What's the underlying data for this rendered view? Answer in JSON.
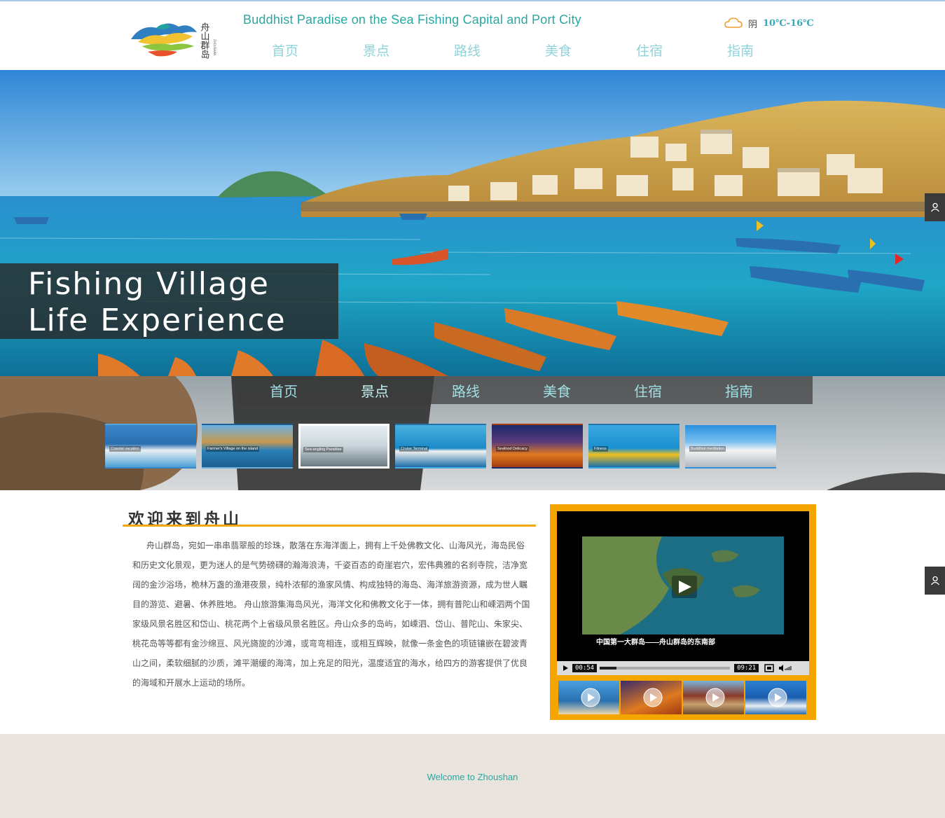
{
  "header": {
    "slogan": "Buddhist Paradise on the Sea Fishing Capital and Port City",
    "logo_text": "舟山群岛",
    "weather": {
      "condition": "阴",
      "temperature": "10℃-16℃",
      "icon": "cloud-icon"
    },
    "nav": [
      "首页",
      "景点",
      "路线",
      "美食",
      "住宿",
      "指南"
    ]
  },
  "hero": {
    "caption_line1": "Fishing Village",
    "caption_line2": "Life Experience"
  },
  "strip": {
    "nav": [
      "首页",
      "景点",
      "路线",
      "美食",
      "住宿",
      "指南"
    ],
    "thumbs": [
      {
        "label": "Coastal vacation"
      },
      {
        "label": "Farmer's Village on the island"
      },
      {
        "label": "Sea-angling Paradise"
      },
      {
        "label": "Cruise Terminal"
      },
      {
        "label": "Seafood Delicacy"
      },
      {
        "label": "Fitness"
      },
      {
        "label": "Buddhist meditation"
      }
    ]
  },
  "welcome": {
    "title": "欢迎来到舟山",
    "body": "舟山群岛，宛如一串串翡翠般的珍珠，散落在东海洋面上，拥有上千处佛教文化、山海风光，海岛民俗和历史文化景观，更为迷人的是气势磅礴的瀚海浪涛，千姿百态的奇崖岩穴，宏伟典雅的名刹寺院，洁净宽阔的金沙浴场，桅林万盏的渔港夜景，纯朴浓郁的渔家风情、构成独特的海岛、海洋旅游资源，成为世人瞩目的游览、避暑、休养胜地。 舟山旅游集海岛风光，海洋文化和佛教文化于一体，拥有普陀山和嵊泗两个国家级风景名胜区和岱山、桃花两个上省级风景名胜区。舟山众多的岛屿，如嵊泗、岱山、普陀山、朱家尖、桃花岛等等都有金沙绵亘、风光旖旎的沙滩，或弯弯相连，或相互辉映，就像一条金色的项链镶嵌在碧波青山之间，柔软细腻的沙质，滩平潮缓的海湾，加上充足的阳光，温度适宜的海水，给四方的游客提供了优良的海域和开展水上运动的场所。"
  },
  "video": {
    "caption": "中国第一大群岛——舟山群岛的东南部",
    "current_time": "00:54",
    "total_time": "09:21",
    "progress": 0.13
  },
  "footer": {
    "text": "Welcome to Zhoushan"
  }
}
